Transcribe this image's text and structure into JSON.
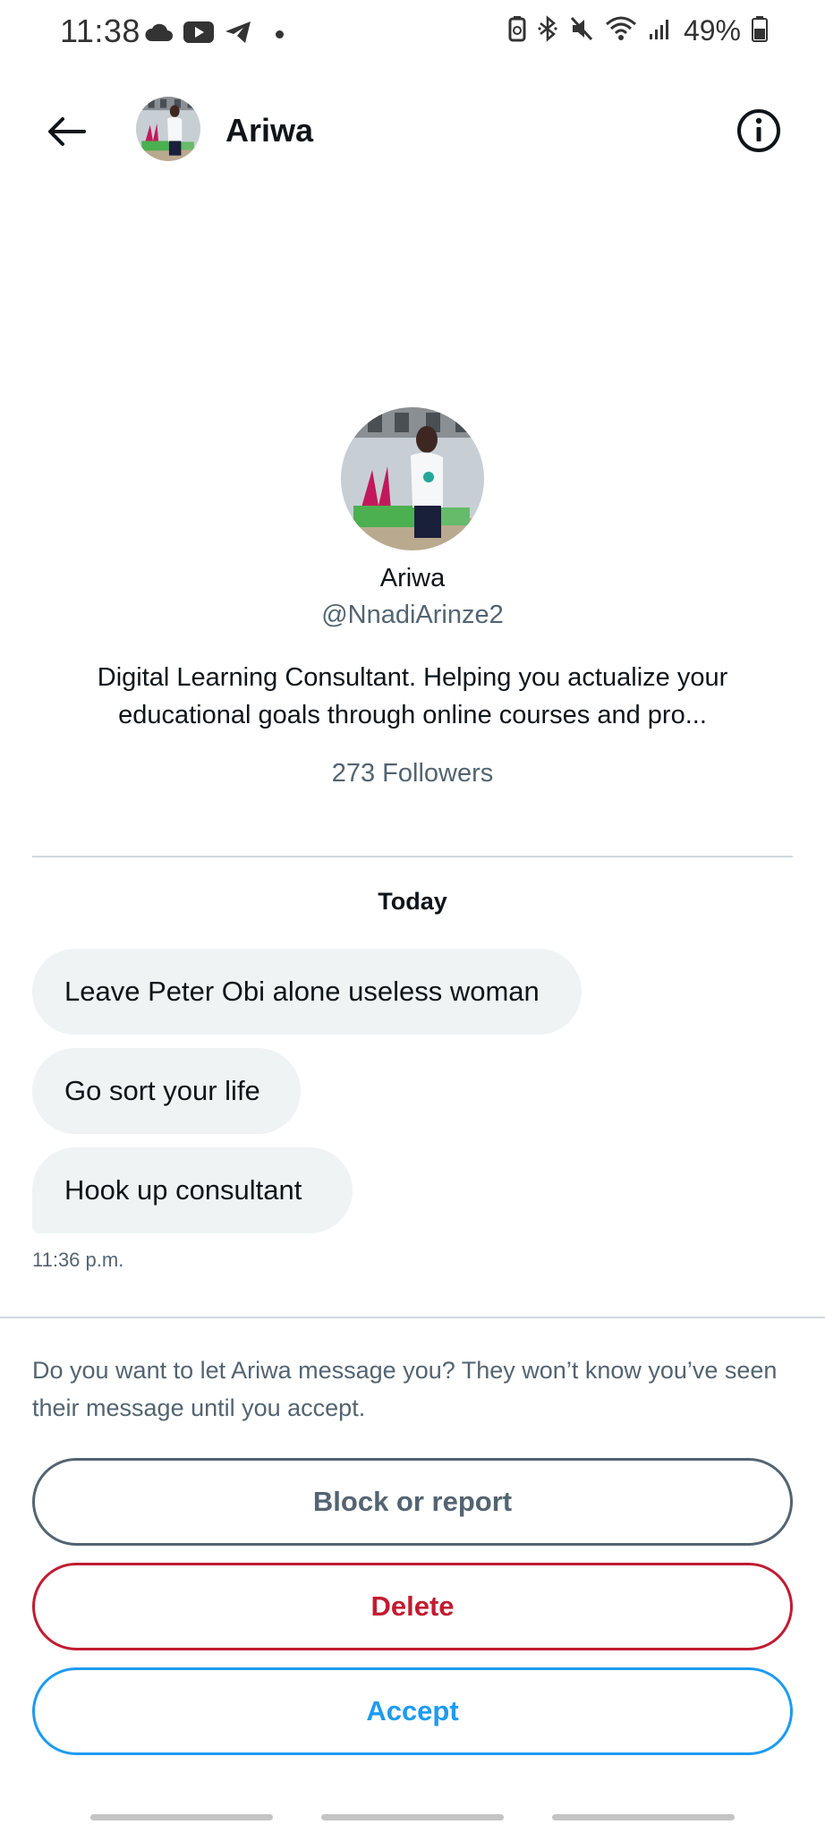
{
  "status_bar": {
    "time": "11:38",
    "battery": "49%",
    "icons_left": [
      "cloud-icon",
      "youtube-icon",
      "telegram-icon"
    ],
    "icons_right": [
      "battery-saver-icon",
      "bluetooth-icon",
      "mute-icon",
      "wifi-icon",
      "signal-icon",
      "battery-icon"
    ]
  },
  "header": {
    "name": "Ariwa"
  },
  "profile": {
    "name": "Ariwa",
    "handle": "@NnadiArinze2",
    "bio": "Digital Learning Consultant. Helping you actualize your educational goals through online courses and pro...",
    "followers": "273 Followers"
  },
  "conversation": {
    "date_label": "Today",
    "messages": [
      "Leave Peter Obi alone useless woman",
      "Go sort your life",
      "Hook up consultant"
    ],
    "timestamp": "11:36 p.m."
  },
  "request": {
    "prompt": "Do you want to let Ariwa message you? They won’t know you’ve seen their message until you accept.",
    "block_label": "Block or report",
    "delete_label": "Delete",
    "accept_label": "Accept"
  },
  "colors": {
    "accent": "#1d9bf0",
    "danger": "#c01c31",
    "muted": "#536471",
    "bubble": "#eff3f4"
  }
}
